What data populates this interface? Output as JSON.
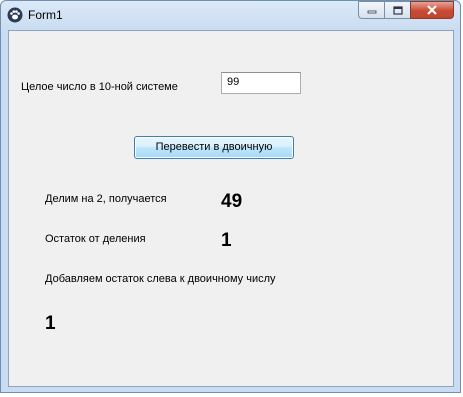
{
  "window": {
    "title": "Form1",
    "icon": "paw-icon",
    "controls": {
      "minimize": "minimize-icon",
      "maximize": "maximize-icon",
      "close": "close-icon"
    }
  },
  "form": {
    "input_label": "Целое число в 10-ной системе",
    "input_value": "99",
    "convert_button": "Перевести в двоичную",
    "divide_label": "Делим на 2, получается",
    "divide_value": "49",
    "remainder_label": "Остаток от деления",
    "remainder_value": "1",
    "append_label": "Добавляем остаток слева к двоичному числу",
    "binary_value": "1"
  },
  "colors": {
    "close_button": "#c74a35",
    "button_border": "#3c7fb1"
  }
}
